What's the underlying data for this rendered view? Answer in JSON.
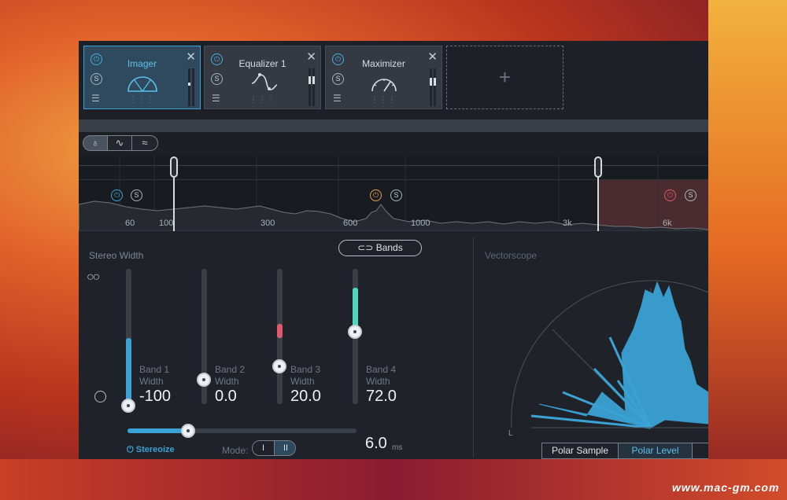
{
  "modules": [
    {
      "title": "Imager",
      "selected": true,
      "close": "✕",
      "power_icon": "power-icon",
      "solo": "S",
      "menu": "☰",
      "dots": "⋮⋮⋮"
    },
    {
      "title": "Equalizer 1",
      "selected": false,
      "close": "✕",
      "power_icon": "power-icon",
      "solo": "S",
      "menu": "☰",
      "dots": "⋮⋮⋮"
    },
    {
      "title": "Maximizer",
      "selected": false,
      "close": "✕",
      "power_icon": "power-icon",
      "solo": "S",
      "menu": "☰",
      "dots": "⋮⋮⋮"
    }
  ],
  "add_slot": {
    "label": "+"
  },
  "toolbar": {
    "icons": [
      "split-person-icon",
      "waveform-icon",
      "spectrum-icon"
    ]
  },
  "spectrum": {
    "freq_labels": [
      "60",
      "100",
      "300",
      "600",
      "1000",
      "3k",
      "6k"
    ],
    "band_solo": "S",
    "band_colors": {
      "band1": "#3aa2d4",
      "band2": "#e0a050",
      "band4": "#e05a6a"
    }
  },
  "stereo_width": {
    "title": "Stereo Width",
    "bands_button": "Bands",
    "bands": [
      {
        "label1": "Band 1",
        "label2": "Width",
        "value": "-100",
        "width": -100
      },
      {
        "label1": "Band 2",
        "label2": "Width",
        "value": "0.0",
        "width": 0
      },
      {
        "label1": "Band 3",
        "label2": "Width",
        "value": "20.0",
        "width": 20
      },
      {
        "label1": "Band 4",
        "label2": "Width",
        "value": "72.0",
        "width": 72
      }
    ],
    "stereoize": {
      "label": "Stereoize",
      "fraction": 0.27
    },
    "mode": {
      "label": "Mode:",
      "options": [
        "I",
        "II"
      ],
      "selected": "II"
    },
    "delay": {
      "value": "6.0",
      "unit": "ms"
    }
  },
  "vectorscope": {
    "title": "Vectorscope",
    "left_label": "L",
    "tabs": [
      "Polar Sample",
      "Polar Level"
    ],
    "active_tab": "Polar Level"
  },
  "watermark": "www.mac-gm.com",
  "colors": {
    "accent": "#3aa2d4",
    "teal": "#4fd8c0",
    "red": "#e05a6a"
  }
}
